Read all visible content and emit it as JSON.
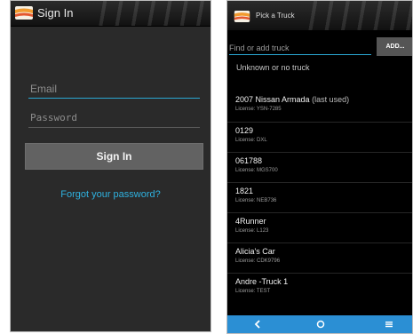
{
  "sign_in_screen": {
    "title": "Sign In",
    "email_placeholder": "Email",
    "password_placeholder": "Password",
    "sign_in_label": "Sign In",
    "forgot_password_label": "Forgot your password?"
  },
  "pick_truck_screen": {
    "title": "Pick a Truck",
    "search_placeholder": "Find or add truck",
    "add_label": "ADD...",
    "no_truck_label": "Unknown or no truck",
    "trucks": [
      {
        "name": "2007 Nissan Armada",
        "suffix": "(last used)",
        "license": "License: YSN-7285"
      },
      {
        "name": "0129",
        "suffix": "",
        "license": "License: DXL"
      },
      {
        "name": "061788",
        "suffix": "",
        "license": "License: MGS700"
      },
      {
        "name": "1821",
        "suffix": "",
        "license": "License: NEB736"
      },
      {
        "name": "4Runner",
        "suffix": "",
        "license": "License: L123"
      },
      {
        "name": "Alicia's Car",
        "suffix": "",
        "license": "License: CDK9796"
      },
      {
        "name": "Andre -Truck 1",
        "suffix": "",
        "license": "License: TEST"
      }
    ],
    "nav": {
      "back_icon": "back-icon",
      "home_icon": "home-icon",
      "menu_icon": "menu-icon"
    }
  },
  "colors": {
    "accent_blue": "#2fb1df",
    "nav_bar_blue": "#2b8fd4",
    "logo_orange": "#f29a2e"
  }
}
